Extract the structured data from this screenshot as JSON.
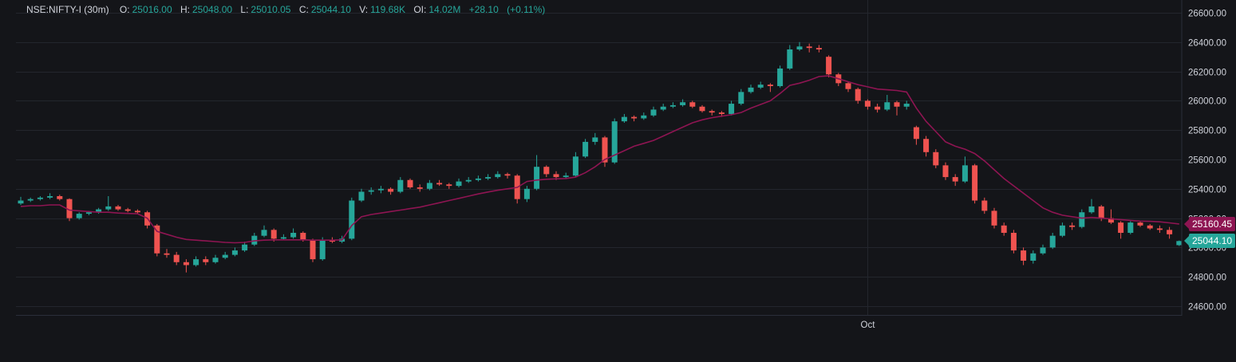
{
  "header": {
    "symbol": "NSE:NIFTY-I (30m)",
    "open_label": "O:",
    "open": "25016.00",
    "high_label": "H:",
    "high": "25048.00",
    "low_label": "L:",
    "low": "25010.05",
    "close_label": "C:",
    "close": "25044.10",
    "volume_label": "V:",
    "volume": "119.68K",
    "oi_label": "OI:",
    "oi": "14.02M",
    "change": "+28.10",
    "change_pct": "(+0.11%)"
  },
  "price_tags": {
    "ma_value": "25160.45",
    "last_price": "25044.10"
  },
  "colors": {
    "background": "#141519",
    "up": "#26a69a",
    "down": "#ef5350",
    "ma": "#8e1552",
    "grid": "#23262d"
  },
  "chart_data": {
    "type": "candlestick",
    "title": "NSE:NIFTY-I (30m)",
    "ylim": [
      24600,
      26600
    ],
    "y_ticks": [
      "24600.00",
      "24800.00",
      "25000.00",
      "25200.00",
      "25400.00",
      "25600.00",
      "25800.00",
      "26000.00",
      "26200.00",
      "26400.00",
      "26600.00"
    ],
    "x_ticks": [
      {
        "label": "Oct",
        "index": 87
      }
    ],
    "grid": true,
    "candles": [
      [
        25300,
        25345,
        25290,
        25320
      ],
      [
        25320,
        25340,
        25310,
        25330
      ],
      [
        25330,
        25350,
        25320,
        25340
      ],
      [
        25340,
        25370,
        25330,
        25350
      ],
      [
        25350,
        25360,
        25320,
        25330
      ],
      [
        25330,
        25335,
        25180,
        25200
      ],
      [
        25200,
        25240,
        25190,
        25230
      ],
      [
        25230,
        25250,
        25220,
        25240
      ],
      [
        25240,
        25270,
        25230,
        25260
      ],
      [
        25260,
        25350,
        25250,
        25280
      ],
      [
        25280,
        25290,
        25250,
        25260
      ],
      [
        25260,
        25270,
        25240,
        25250
      ],
      [
        25250,
        25260,
        25230,
        25240
      ],
      [
        25240,
        25250,
        25130,
        25150
      ],
      [
        25150,
        25160,
        24940,
        24960
      ],
      [
        24960,
        24990,
        24930,
        24950
      ],
      [
        24950,
        24970,
        24880,
        24900
      ],
      [
        24900,
        24920,
        24830,
        24880
      ],
      [
        24880,
        24940,
        24870,
        24920
      ],
      [
        24920,
        24940,
        24880,
        24900
      ],
      [
        24900,
        24950,
        24890,
        24930
      ],
      [
        24930,
        24970,
        24920,
        24950
      ],
      [
        24950,
        25000,
        24940,
        24980
      ],
      [
        24980,
        25040,
        24970,
        25020
      ],
      [
        25020,
        25100,
        25010,
        25080
      ],
      [
        25080,
        25150,
        25070,
        25120
      ],
      [
        25120,
        25130,
        25040,
        25060
      ],
      [
        25060,
        25090,
        25050,
        25070
      ],
      [
        25070,
        25130,
        25060,
        25100
      ],
      [
        25100,
        25110,
        25040,
        25050
      ],
      [
        25050,
        25060,
        24900,
        24920
      ],
      [
        24920,
        25070,
        24910,
        25050
      ],
      [
        25050,
        25070,
        25030,
        25040
      ],
      [
        25040,
        25080,
        25030,
        25060
      ],
      [
        25060,
        25340,
        25050,
        25320
      ],
      [
        25320,
        25400,
        25310,
        25380
      ],
      [
        25380,
        25410,
        25360,
        25390
      ],
      [
        25390,
        25420,
        25370,
        25400
      ],
      [
        25400,
        25410,
        25360,
        25380
      ],
      [
        25380,
        25480,
        25370,
        25460
      ],
      [
        25460,
        25470,
        25400,
        25410
      ],
      [
        25410,
        25430,
        25380,
        25400
      ],
      [
        25400,
        25460,
        25390,
        25440
      ],
      [
        25440,
        25460,
        25420,
        25430
      ],
      [
        25430,
        25440,
        25400,
        25420
      ],
      [
        25420,
        25470,
        25410,
        25450
      ],
      [
        25450,
        25480,
        25440,
        25460
      ],
      [
        25460,
        25490,
        25450,
        25470
      ],
      [
        25470,
        25500,
        25460,
        25480
      ],
      [
        25480,
        25520,
        25470,
        25500
      ],
      [
        25500,
        25510,
        25470,
        25490
      ],
      [
        25490,
        25500,
        25300,
        25330
      ],
      [
        25330,
        25420,
        25310,
        25400
      ],
      [
        25400,
        25630,
        25390,
        25550
      ],
      [
        25550,
        25560,
        25480,
        25500
      ],
      [
        25500,
        25520,
        25460,
        25480
      ],
      [
        25480,
        25510,
        25470,
        25490
      ],
      [
        25490,
        25650,
        25480,
        25620
      ],
      [
        25620,
        25740,
        25610,
        25720
      ],
      [
        25720,
        25780,
        25700,
        25750
      ],
      [
        25750,
        25760,
        25550,
        25580
      ],
      [
        25580,
        25880,
        25570,
        25860
      ],
      [
        25860,
        25910,
        25850,
        25890
      ],
      [
        25890,
        25900,
        25860,
        25880
      ],
      [
        25880,
        25920,
        25870,
        25900
      ],
      [
        25900,
        25960,
        25890,
        25940
      ],
      [
        25940,
        25980,
        25930,
        25960
      ],
      [
        25960,
        25990,
        25950,
        25970
      ],
      [
        25970,
        26010,
        25960,
        25990
      ],
      [
        25990,
        26000,
        25950,
        25960
      ],
      [
        25960,
        25970,
        25920,
        25930
      ],
      [
        25930,
        25940,
        25900,
        25920
      ],
      [
        25920,
        25930,
        25890,
        25910
      ],
      [
        25910,
        26000,
        25900,
        25980
      ],
      [
        25980,
        26080,
        25970,
        26060
      ],
      [
        26060,
        26110,
        26050,
        26090
      ],
      [
        26090,
        26130,
        26080,
        26110
      ],
      [
        26110,
        26120,
        26060,
        26100
      ],
      [
        26100,
        26240,
        26090,
        26220
      ],
      [
        26220,
        26380,
        26210,
        26350
      ],
      [
        26350,
        26400,
        26340,
        26370
      ],
      [
        26370,
        26390,
        26330,
        26360
      ],
      [
        26360,
        26380,
        26330,
        26350
      ],
      [
        26300,
        26310,
        26160,
        26180
      ],
      [
        26180,
        26190,
        26100,
        26120
      ],
      [
        26120,
        26130,
        26060,
        26080
      ],
      [
        26080,
        26090,
        25980,
        26000
      ],
      [
        26000,
        26010,
        25940,
        25960
      ],
      [
        25960,
        25980,
        25920,
        25940
      ],
      [
        25940,
        26040,
        25930,
        25990
      ],
      [
        25990,
        26000,
        25900,
        25960
      ],
      [
        25960,
        26000,
        25940,
        25980
      ],
      [
        25820,
        25830,
        25700,
        25740
      ],
      [
        25740,
        25760,
        25620,
        25650
      ],
      [
        25650,
        25670,
        25540,
        25560
      ],
      [
        25560,
        25580,
        25460,
        25480
      ],
      [
        25480,
        25500,
        25420,
        25450
      ],
      [
        25450,
        25620,
        25440,
        25560
      ],
      [
        25560,
        25570,
        25300,
        25320
      ],
      [
        25320,
        25340,
        25230,
        25250
      ],
      [
        25250,
        25270,
        25130,
        25150
      ],
      [
        25150,
        25170,
        25080,
        25100
      ],
      [
        25100,
        25120,
        24960,
        24980
      ],
      [
        24980,
        25000,
        24880,
        24910
      ],
      [
        24910,
        24980,
        24890,
        24960
      ],
      [
        24960,
        25020,
        24950,
        25000
      ],
      [
        25000,
        25100,
        24990,
        25080
      ],
      [
        25080,
        25170,
        25070,
        25150
      ],
      [
        25150,
        25170,
        25120,
        25140
      ],
      [
        25140,
        25260,
        25130,
        25240
      ],
      [
        25240,
        25330,
        25230,
        25280
      ],
      [
        25280,
        25290,
        25180,
        25200
      ],
      [
        25200,
        25260,
        25160,
        25170
      ],
      [
        25170,
        25180,
        25060,
        25100
      ],
      [
        25100,
        25180,
        25090,
        25170
      ],
      [
        25170,
        25180,
        25140,
        25150
      ],
      [
        25150,
        25160,
        25120,
        25130
      ],
      [
        25130,
        25150,
        25100,
        25120
      ],
      [
        25120,
        25140,
        25060,
        25090
      ],
      [
        25016,
        25048,
        25010,
        25044
      ]
    ],
    "moving_average": [
      25280,
      25285,
      25285,
      25290,
      25290,
      25255,
      25250,
      25245,
      25240,
      25240,
      25235,
      25232,
      25230,
      25200,
      25110,
      25090,
      25070,
      25055,
      25050,
      25045,
      25040,
      25035,
      25032,
      25035,
      25045,
      25050,
      25052,
      25052,
      25052,
      25052,
      25050,
      25050,
      25050,
      25052,
      25150,
      25210,
      25225,
      25235,
      25245,
      25255,
      25265,
      25275,
      25290,
      25305,
      25320,
      25335,
      25350,
      25365,
      25378,
      25390,
      25400,
      25410,
      25450,
      25460,
      25465,
      25468,
      25470,
      25480,
      25510,
      25550,
      25600,
      25630,
      25660,
      25690,
      25710,
      25730,
      25760,
      25790,
      25820,
      25850,
      25870,
      25885,
      25895,
      25905,
      25920,
      25950,
      25975,
      26000,
      26050,
      26105,
      26120,
      26140,
      26165,
      26170,
      26150,
      26130,
      26110,
      26095,
      26080,
      26075,
      26070,
      26060,
      25950,
      25860,
      25790,
      25720,
      25690,
      25670,
      25640,
      25590,
      25530,
      25470,
      25420,
      25370,
      25320,
      25270,
      25240,
      25220,
      25210,
      25200,
      25205,
      25200,
      25195,
      25190,
      25185,
      25180,
      25178,
      25175,
      25168,
      25160.45
    ]
  }
}
